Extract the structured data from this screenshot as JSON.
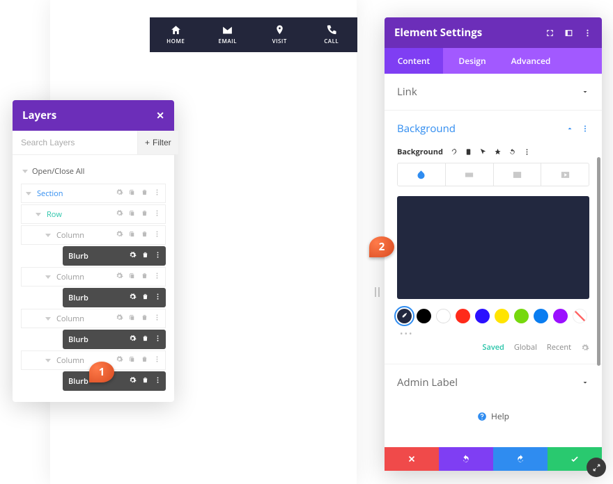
{
  "top_nav": [
    {
      "label": "HOME",
      "icon": "home-icon"
    },
    {
      "label": "EMAIL",
      "icon": "email-icon"
    },
    {
      "label": "VISIT",
      "icon": "pin-icon"
    },
    {
      "label": "CALL",
      "icon": "phone-icon"
    }
  ],
  "layers_panel": {
    "title": "Layers",
    "search_placeholder": "Search Layers",
    "filter_label": "Filter",
    "openclose_label": "Open/Close All",
    "rows": [
      {
        "type": "section",
        "label": "Section"
      },
      {
        "type": "rowtype",
        "label": "Row"
      },
      {
        "type": "column",
        "label": "Column"
      },
      {
        "type": "blurb",
        "label": "Blurb"
      },
      {
        "type": "column",
        "label": "Column"
      },
      {
        "type": "blurb",
        "label": "Blurb"
      },
      {
        "type": "column",
        "label": "Column"
      },
      {
        "type": "blurb",
        "label": "Blurb"
      },
      {
        "type": "column",
        "label": "Column"
      },
      {
        "type": "blurb",
        "label": "Blurb"
      }
    ]
  },
  "callouts": {
    "one": "1",
    "two": "2"
  },
  "settings": {
    "title": "Element Settings",
    "tabs": {
      "content": "Content",
      "design": "Design",
      "advanced": "Advanced"
    },
    "sections": {
      "link": "Link",
      "background": "Background",
      "admin_label": "Admin Label"
    },
    "bg_label": "Background",
    "swatch_tabs": {
      "saved": "Saved",
      "global": "Global",
      "recent": "Recent"
    },
    "help": "Help",
    "preview_color": "#22283f",
    "swatches": [
      {
        "name": "eyedrop",
        "color": "#22283f"
      },
      {
        "name": "black",
        "color": "#000000"
      },
      {
        "name": "white",
        "color": "#ffffff"
      },
      {
        "name": "red",
        "color": "#ff2a1a"
      },
      {
        "name": "blue",
        "color": "#2b10ff"
      },
      {
        "name": "yellow",
        "color": "#ffe400"
      },
      {
        "name": "lime",
        "color": "#76d80d"
      },
      {
        "name": "blue2",
        "color": "#0a7df0"
      },
      {
        "name": "purple",
        "color": "#9b10ff"
      },
      {
        "name": "none",
        "color": "none"
      }
    ]
  }
}
